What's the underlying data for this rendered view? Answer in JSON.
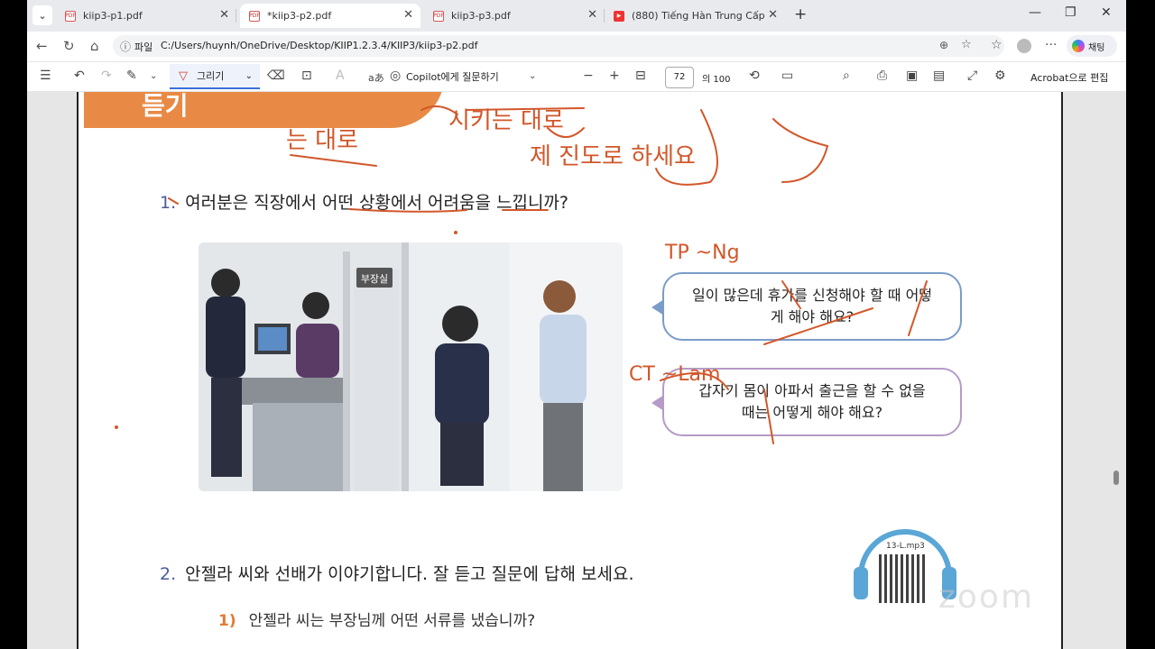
{
  "tabs": [
    {
      "title": "kiip3-p1.pdf"
    },
    {
      "title": "*kiip3-p2.pdf"
    },
    {
      "title": "kiip3-p3.pdf"
    },
    {
      "title": "(880) Tiếng Hàn Trung Cấp 1 tối 2/"
    }
  ],
  "address": {
    "label": "파일",
    "url": "C:/Users/huynh/OneDrive/Desktop/KIIP1.2.3.4/KIIP3/kiip3-p2.pdf"
  },
  "chat_label": "채팅",
  "pdf_toolbar": {
    "draw_label": "그리기",
    "copilot_label": "Copilot에게 질문하기",
    "page_current": "72",
    "page_total": "의 100",
    "acrobat_edit": "Acrobat으로 편집",
    "text_icon_label": "aあ"
  },
  "document": {
    "header": "듣기",
    "q1_num": "1.",
    "q1": "여러분은 직장에서 어떤 상황에서 어려움을 느낍니까?",
    "bubble1": "일이 많은데 휴가를 신청해야 할 때 어떻게 해야 해요?",
    "bubble2": "갑자기 몸이 아파서 출근을 할 수 없을 때는 어떻게 해야 해요?",
    "office_sign": "부장실",
    "q2_num": "2.",
    "q2": "안젤라 씨와 선배가 이야기합니다. 잘 듣고 질문에 답해 보세요.",
    "q2_1_num": "1)",
    "q2_1": "안젤라 씨는 부장님께 어떤 서류를 냈습니까?",
    "audio_file": "13-L.mp3"
  },
  "annotations": {
    "ink1": "는 대로",
    "ink2": "시키는 대로",
    "ink3": "제 진도로 하세요",
    "ink4": "TP ~Ng",
    "ink5": "CT ~Lam"
  },
  "watermark": "zoom"
}
